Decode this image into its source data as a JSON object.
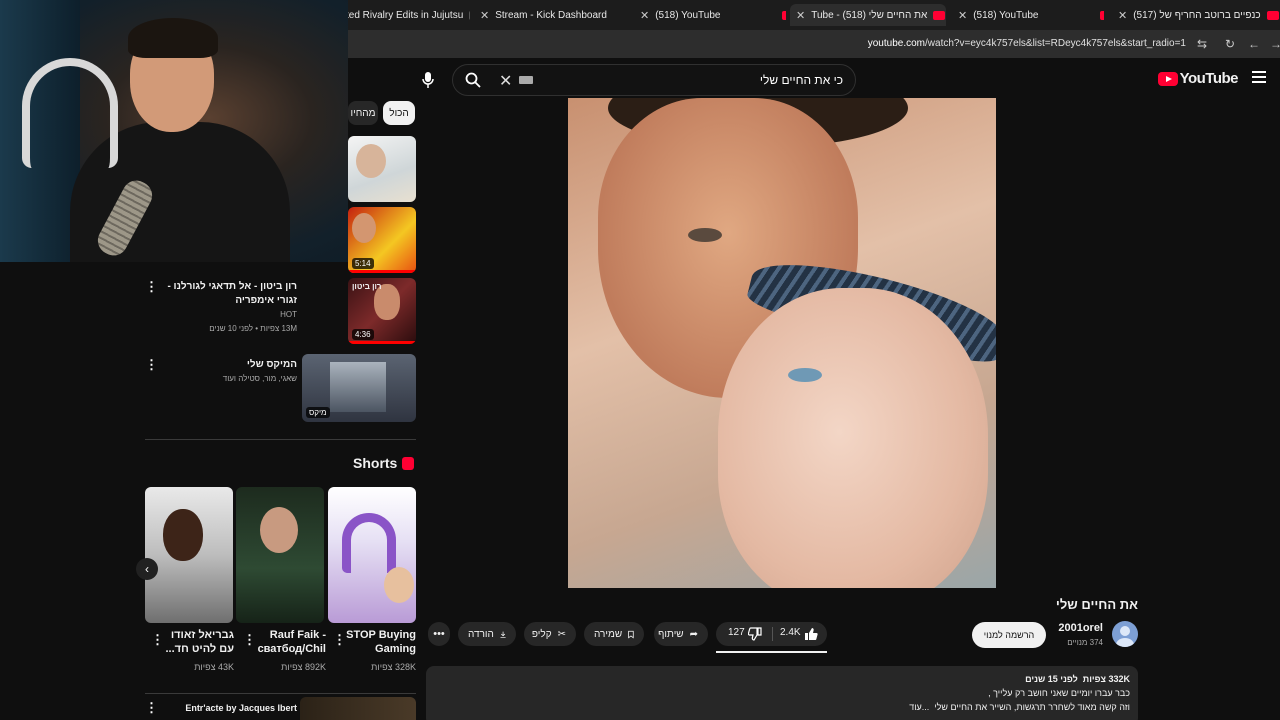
{
  "browser": {
    "tabs": [
      {
        "label": "ted Rivalry Edits in Jujutsu",
        "favicon": "tt-icon"
      },
      {
        "label": "Stream - Kick Dashboard",
        "favicon": "kick-icon"
      },
      {
        "label": "(518) YouTube",
        "favicon": "youtube-icon"
      },
      {
        "label": "Tube - את החיים שלי (518)",
        "favicon": "youtube-icon"
      },
      {
        "label": "(518) YouTube",
        "favicon": "youtube-icon"
      },
      {
        "label": "(517) כנפיים ברוטב החריף של",
        "favicon": "youtube-icon"
      }
    ],
    "url_host": "youtube.com",
    "url_path": "/watch?v=eyc4k757els&list=RDeyc4k757els&start_radio=1"
  },
  "youtube": {
    "logo": "YouTube",
    "search_query": "כי את החיים שלי",
    "chips": {
      "all": "הכול",
      "second": "מהחיו"
    },
    "sidebar": [
      {
        "duration": "5:14"
      },
      {
        "title": "רון ביטון - אל תדאגי לגורלנו - זגורי אימפריה",
        "channel": "HOT",
        "meta": "13M צפיות • לפני 10 שנים",
        "duration": "4:36",
        "thumb_text": "רון ביטון"
      },
      {
        "title": "המיקס שלי",
        "meta": "שאגי, מור, סטילה ועוד",
        "duration": "מיקס"
      }
    ],
    "shorts_label": "Shorts",
    "shorts": [
      {
        "title": "STOP Buying Gaming",
        "views": "328K צפיות"
      },
      {
        "title": "Rauf Faik - сватбод/Chil",
        "views": "892K צפיות"
      },
      {
        "title": "גבריאל זאודו עם להיט חד...",
        "views": "43K צפיות"
      }
    ],
    "bottom_item": {
      "title": "Entr'acte by Jacques Ibert"
    },
    "video": {
      "title": "את החיים שלי",
      "channel": "2001orel",
      "subscribers": "374 מנויים",
      "subscribe_label": "הרשמה למנוי",
      "likes": "2.4K",
      "dislikes": "127",
      "share": "שיתוף",
      "save": "שמירה",
      "clip": "קליפ",
      "download": "הורדה"
    },
    "description": {
      "views": "332K צפיות",
      "age": "לפני 15 שנים",
      "line1": "כבר עברו יומיים שאני חושב רק עלייך ,",
      "line2": "וזה קשה מאוד לשחרר תרגשות, השייר את החיים שלי",
      "more": "...עוד"
    }
  },
  "colors": {
    "brand": "#ff0033",
    "bg": "#0f0f0f",
    "chip": "#272727"
  }
}
